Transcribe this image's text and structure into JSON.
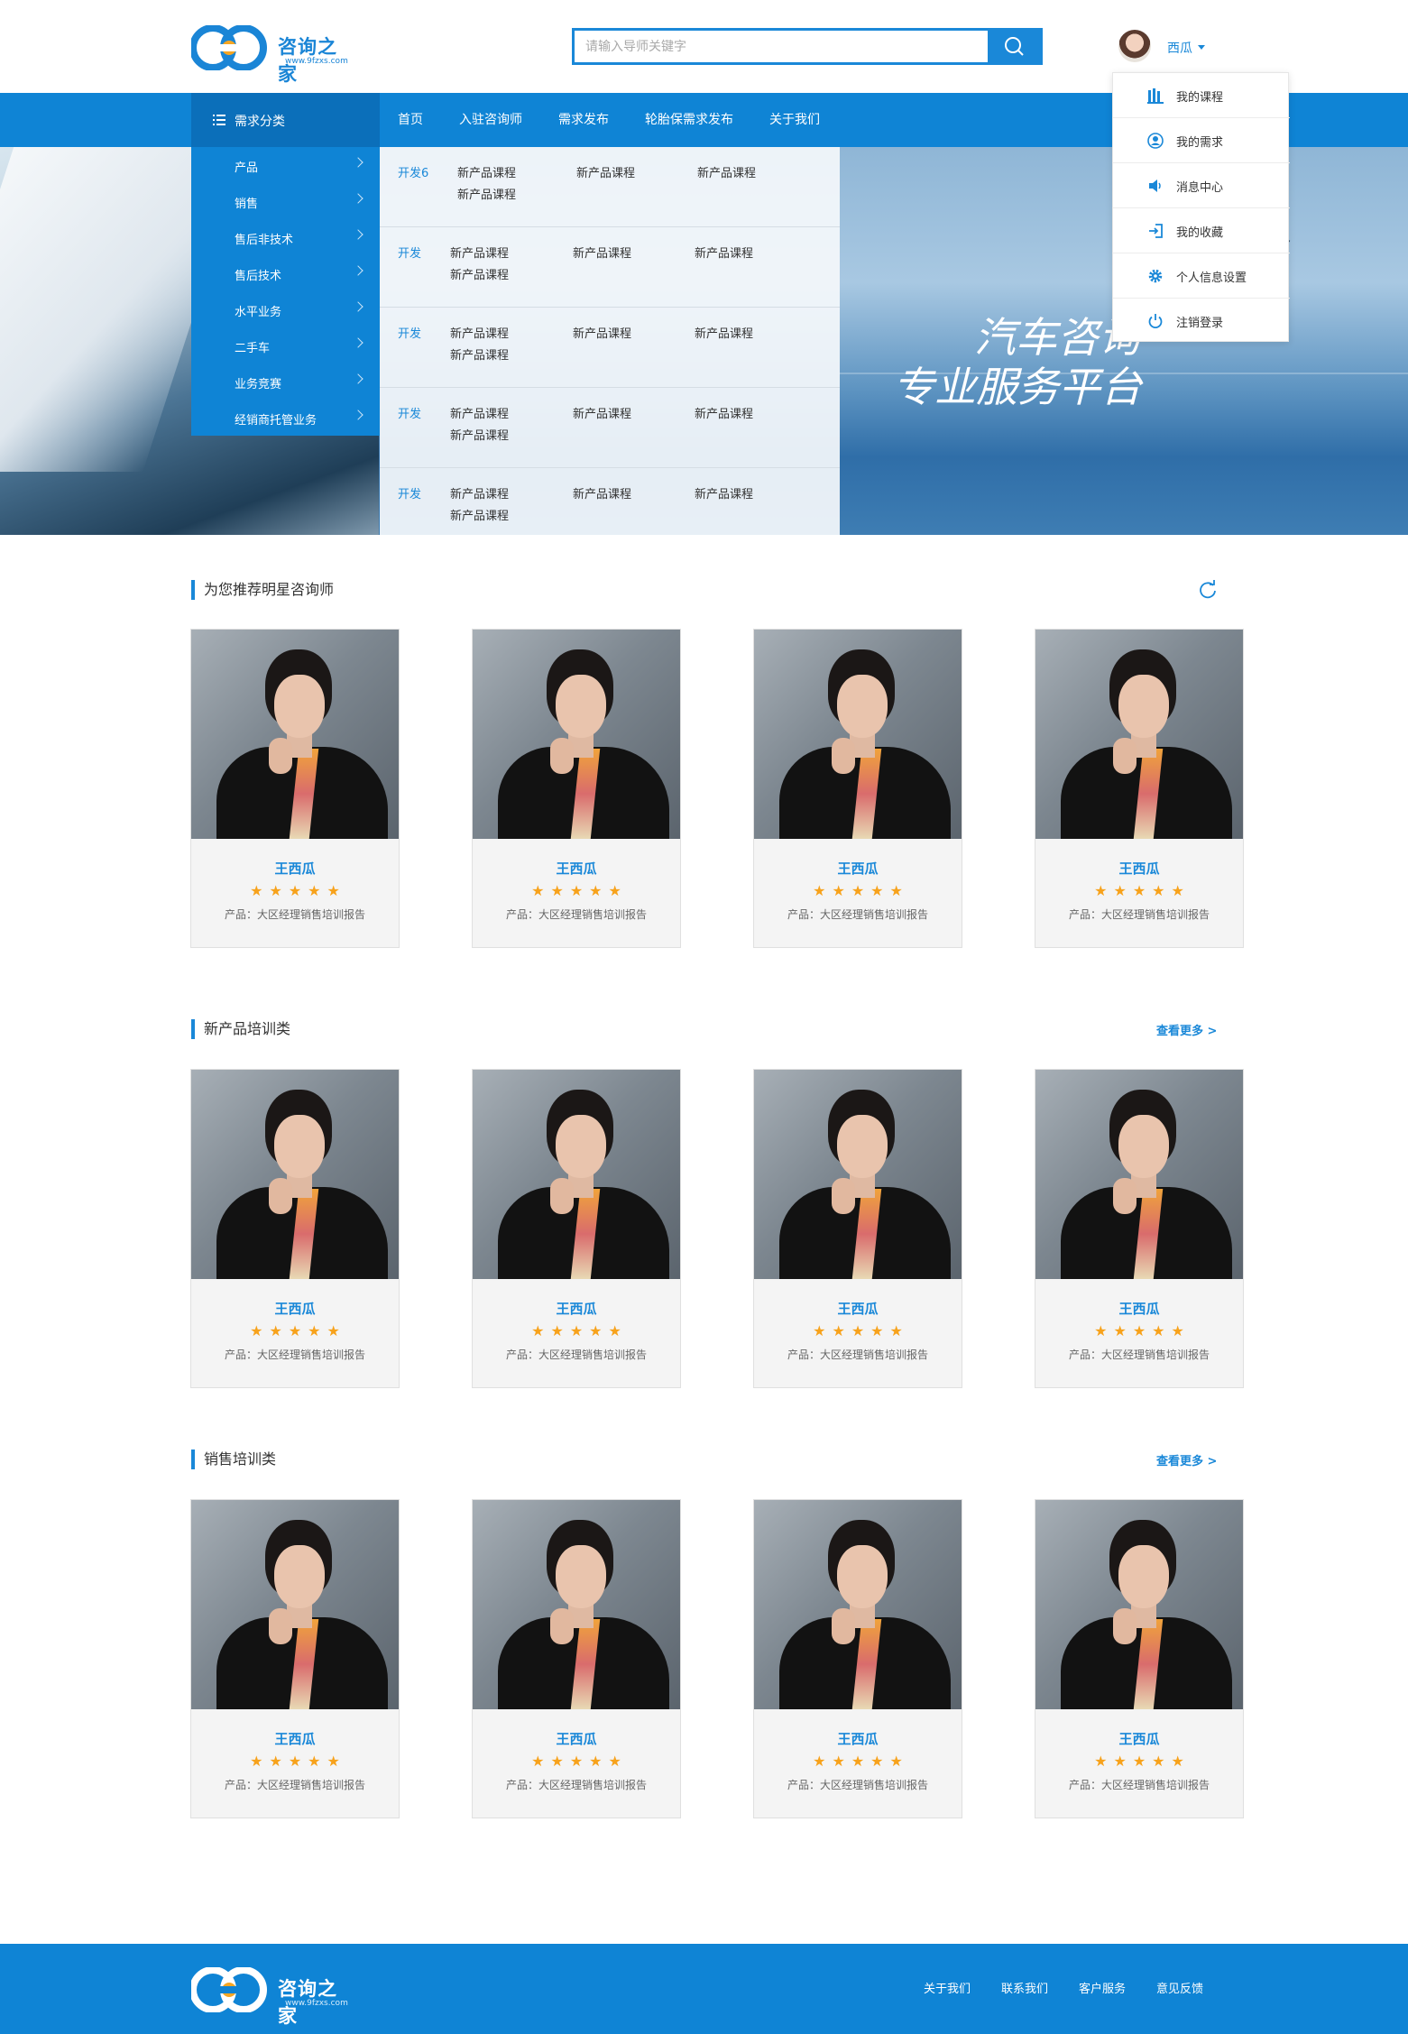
{
  "site": {
    "logo_text": "咨询之家",
    "logo_sub": "www.9fzxs.com"
  },
  "search": {
    "placeholder": "请输入导师关键字"
  },
  "user": {
    "name": "西瓜"
  },
  "nav": {
    "category_label": "需求分类",
    "items": [
      "首页",
      "入驻咨询师",
      "需求发布",
      "轮胎保需求发布",
      "关于我们"
    ]
  },
  "categories": [
    "产品",
    "销售",
    "售后非技术",
    "售后技术",
    "水平业务",
    "二手车",
    "业务竞赛",
    "经销商托管业务"
  ],
  "sub_panel": {
    "rows": [
      {
        "head": "开发6",
        "links": [
          "新产品课程",
          "新产品课程",
          "新产品课程",
          "新产品课程"
        ]
      },
      {
        "head": "开发",
        "links": [
          "新产品课程",
          "新产品课程",
          "新产品课程",
          "新产品课程"
        ]
      },
      {
        "head": "开发",
        "links": [
          "新产品课程",
          "新产品课程",
          "新产品课程",
          "新产品课程"
        ]
      },
      {
        "head": "开发",
        "links": [
          "新产品课程",
          "新产品课程",
          "新产品课程",
          "新产品课程"
        ]
      },
      {
        "head": "开发",
        "links": [
          "新产品课程",
          "新产品课程",
          "新产品课程",
          "新产品课程"
        ]
      }
    ]
  },
  "banner": {
    "line1": "汽车咨询",
    "line2": "专业服务平台"
  },
  "user_menu": [
    {
      "label": "我的课程",
      "icon": "books-icon"
    },
    {
      "label": "我的需求",
      "icon": "user-circle-icon"
    },
    {
      "label": "消息中心",
      "icon": "speaker-icon"
    },
    {
      "label": "我的收藏",
      "icon": "sign-in-icon"
    },
    {
      "label": "个人信息设置",
      "icon": "gear-icon"
    },
    {
      "label": "注销登录",
      "icon": "power-icon"
    }
  ],
  "sections": [
    {
      "title": "为您推荐明星咨询师",
      "more": ""
    },
    {
      "title": "新产品培训类",
      "more": "查看更多 >"
    },
    {
      "title": "销售培训类",
      "more": "查看更多 >"
    }
  ],
  "card": {
    "name": "王西瓜",
    "stars": "★★★★★",
    "rating": 5,
    "desc": "产品：大区经理销售培训报告"
  },
  "footer": {
    "links": [
      "关于我们",
      "联系我们",
      "客户服务",
      "意见反馈"
    ]
  },
  "colors": {
    "primary": "#0f84d5",
    "primary_dark": "#0b6fba",
    "star": "#f7a21b"
  }
}
